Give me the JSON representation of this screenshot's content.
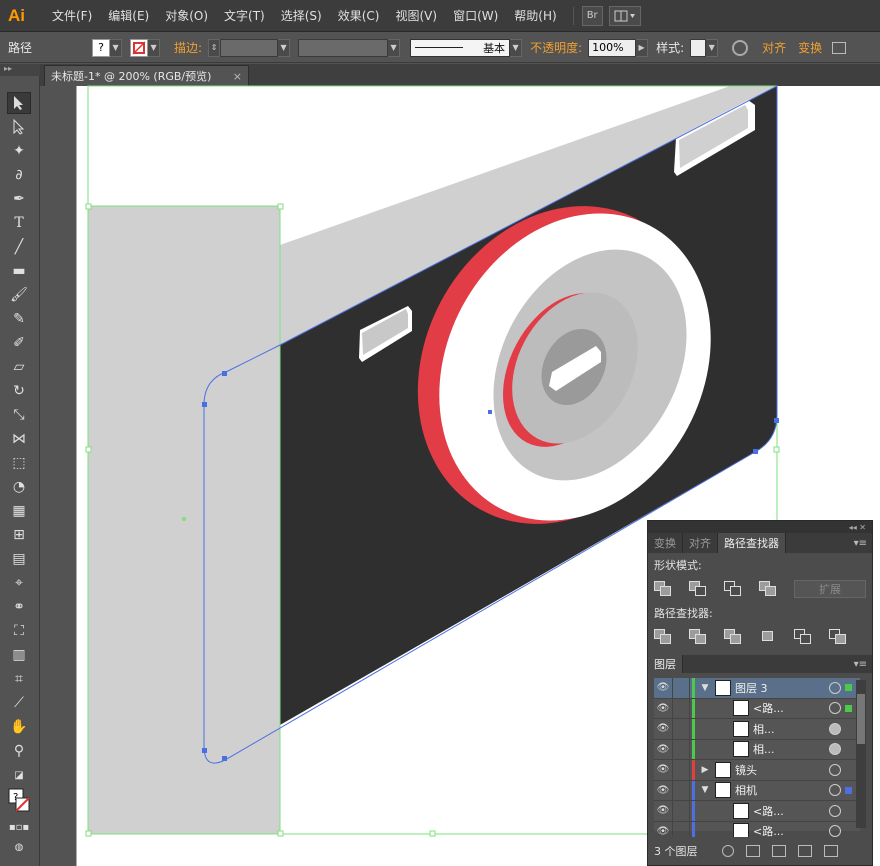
{
  "app": {
    "logo": "Ai"
  },
  "menu": {
    "items": [
      "文件(F)",
      "编辑(E)",
      "对象(O)",
      "文字(T)",
      "选择(S)",
      "效果(C)",
      "视图(V)",
      "窗口(W)",
      "帮助(H)"
    ],
    "bridge_btn": "Br"
  },
  "control": {
    "object_type": "路径",
    "fill_glyph": "?",
    "stroke_label": "描边:",
    "stroke_style": "基本",
    "opacity_label": "不透明度:",
    "opacity_value": "100%",
    "style_label": "样式:",
    "align_label": "对齐",
    "transform_label": "变换"
  },
  "document": {
    "tab_title": "未标题-1* @ 200% (RGB/预览)",
    "close_glyph": "×"
  },
  "tools": {
    "header": "▸▸"
  },
  "panel": {
    "collapse_glyph": "◂◂  ✕",
    "tabs": [
      "变换",
      "对齐",
      "路径查找器"
    ],
    "active_tab": "路径查找器",
    "shape_modes_label": "形状模式:",
    "expand_label": "扩展",
    "pathfinders_label": "路径查找器:",
    "layers_tab": "图层",
    "layers": [
      {
        "name": "图层 3",
        "indent": 0,
        "expanded": true,
        "color": "#4cc94c",
        "selected": true,
        "target_filled": false,
        "sel_color": "#4cc94c"
      },
      {
        "name": "<路...",
        "indent": 1,
        "expanded": null,
        "color": "#4cc94c",
        "selected": false,
        "target_filled": false,
        "sel_color": "#4cc94c"
      },
      {
        "name": "相...",
        "indent": 1,
        "expanded": null,
        "color": "#4cc94c",
        "selected": false,
        "target_filled": true,
        "sel_color": ""
      },
      {
        "name": "相...",
        "indent": 1,
        "expanded": null,
        "color": "#4cc94c",
        "selected": false,
        "target_filled": true,
        "sel_color": ""
      },
      {
        "name": "镜头",
        "indent": 0,
        "expanded": false,
        "color": "#e04040",
        "selected": false,
        "target_filled": false,
        "sel_color": ""
      },
      {
        "name": "相机",
        "indent": 0,
        "expanded": true,
        "color": "#4d6fe0",
        "selected": false,
        "target_filled": false,
        "sel_color": "#4d6fe0"
      },
      {
        "name": "<路...",
        "indent": 1,
        "expanded": null,
        "color": "#4d6fe0",
        "selected": false,
        "target_filled": false,
        "sel_color": ""
      },
      {
        "name": "<路...",
        "indent": 1,
        "expanded": null,
        "color": "#4d6fe0",
        "selected": false,
        "target_filled": false,
        "sel_color": ""
      }
    ],
    "layer_count": "3 个图层"
  },
  "colors": {
    "camera_body": "#2f2f2f",
    "camera_top": "#d0d0d0",
    "lens_red": "#e23c46",
    "lens_white": "#ffffff",
    "lens_gray": "#c8c8c8",
    "selection_blue": "#4a6fe3",
    "artboard_green": "#7ee07e"
  }
}
